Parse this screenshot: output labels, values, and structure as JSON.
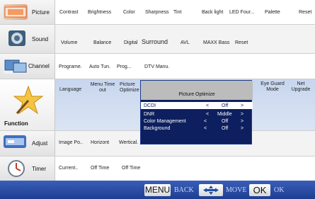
{
  "categories": [
    {
      "label": "Picture",
      "icon": "picture-icon"
    },
    {
      "label": "Sound",
      "icon": "speaker-icon"
    },
    {
      "label": "Channel",
      "icon": "tv-channel-icon"
    },
    {
      "label": "Function",
      "icon": "function-star-icon"
    },
    {
      "label": "Adjust",
      "icon": "adjust-icon"
    },
    {
      "label": "Timer",
      "icon": "timer-clock-icon"
    }
  ],
  "picture_items": [
    "Contrast",
    "Brightness",
    "Color",
    "Sharpness",
    "Tint",
    "Back light",
    "LED Four...",
    "Palette",
    "Reset"
  ],
  "sound_items": [
    "Volume",
    "Balance",
    "Digital",
    "Surround",
    "AVL",
    "MAXX Bass",
    "Reset"
  ],
  "channel_items": [
    "Programe.",
    "Auto Tun.",
    "Prog...",
    "DTV Manu."
  ],
  "function_items": [
    "Language",
    "Menu Time out",
    "Picture Optimize",
    "Eye Guard Mode",
    "Net Upgrade"
  ],
  "adjust_items": [
    "Image Po..",
    "Horizont",
    "Wertical."
  ],
  "timer_items": [
    "Current..",
    "Off Time",
    "Off Time"
  ],
  "popup": {
    "title": "Picture Optimize",
    "rows": [
      {
        "name": "DCDI",
        "left": "<",
        "value": "Off",
        "right": ">",
        "selected": true
      },
      {
        "name": "DNR",
        "left": "<",
        "value": "Middle",
        "right": ">",
        "selected": false
      },
      {
        "name": "Color Management",
        "left": "<",
        "value": "Off",
        "right": ">",
        "selected": false
      },
      {
        "name": "Background",
        "left": "<",
        "value": "Off",
        "right": ">",
        "selected": false
      }
    ]
  },
  "bottom_bar": {
    "menu_key": "MENU",
    "back_label": "BACK",
    "move_label": "MOVE",
    "ok_key": "OK",
    "ok_label": "OK"
  },
  "colors": {
    "popup_bg": "#0d1f5e",
    "selection": "#1f3ca3",
    "bottom_bar": "#2a4ea6",
    "selected_row_bg": "#ffffff"
  }
}
